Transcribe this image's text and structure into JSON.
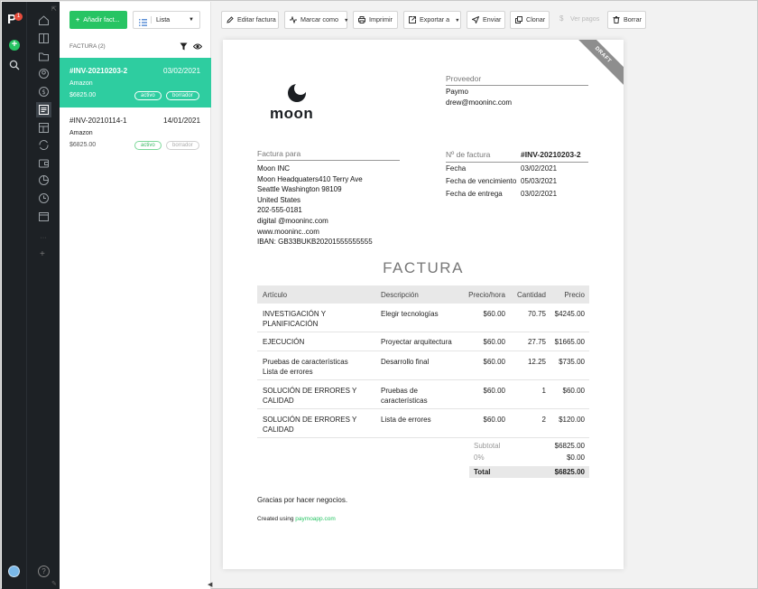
{
  "rail": {
    "logo_letter": "P",
    "notification_count": "1",
    "add_symbol": "+",
    "help_symbol": "?",
    "plus_symbol": "+",
    "divider": "···",
    "nav_icons": [
      "home-icon",
      "projects-icon",
      "folder-icon",
      "contacts-icon",
      "money-icon",
      "invoices-icon",
      "reports-icon",
      "sync-icon",
      "wallet-icon",
      "pie-chart-icon",
      "clock-icon",
      "calendar-icon"
    ]
  },
  "list": {
    "add_button": "Añadir fact...",
    "view_label": "Lista",
    "header": "FACTURA (2)",
    "invoices": [
      {
        "number": "#INV-20210203-2",
        "date": "03/02/2021",
        "client": "Amazon",
        "amount": "$6825.00",
        "badges": [
          "activo",
          "borrador"
        ]
      },
      {
        "number": "#INV-20210114-1",
        "date": "14/01/2021",
        "client": "Amazon",
        "amount": "$6825.00",
        "badges": [
          "activo",
          "borrador"
        ]
      }
    ]
  },
  "toolbar": {
    "edit": "Editar factura",
    "mark_as": "Marcar como",
    "print": "Imprimir",
    "export": "Exportar a",
    "send": "Enviar",
    "clone": "Clonar",
    "payments": "Ver pagos",
    "delete": "Borrar"
  },
  "invoice": {
    "ribbon": "DRAFT",
    "logo_text": "moon",
    "supplier": {
      "label": "Proveedor",
      "name": "Paymo",
      "email": "drew@mooninc.com"
    },
    "bill_to": {
      "label": "Factura para",
      "lines": [
        "Moon INC",
        "Moon Headquaters410 Terry Ave",
        "Seattle Washington 98109",
        "United States",
        "202-555-0181",
        "digital @mooninc.com",
        "www.mooninc..com",
        "IBAN: GB33BUKB20201555555555"
      ]
    },
    "meta": {
      "number_label": "Nº de factura",
      "number": "#INV-20210203-2",
      "date_label": "Fecha",
      "date": "03/02/2021",
      "due_label": "Fecha de vencimiento",
      "due": "05/03/2021",
      "delivery_label": "Fecha de entrega",
      "delivery": "03/02/2021"
    },
    "title": "FACTURA",
    "columns": {
      "item": "Artículo",
      "description": "Descripción",
      "rate": "Precio/hora",
      "qty": "Cantidad",
      "price": "Precio"
    },
    "items": [
      {
        "item": "INVESTIGACIÓN Y PLANIFICACIÓN",
        "description": "Elegir tecnologías",
        "rate": "$60.00",
        "qty": "70.75",
        "price": "$4245.00"
      },
      {
        "item": "EJECUCIÓN",
        "description": "Proyectar arquitectura",
        "rate": "$60.00",
        "qty": "27.75",
        "price": "$1665.00"
      },
      {
        "item": "Pruebas de características Lista de errores",
        "description": "Desarrollo final",
        "rate": "$60.00",
        "qty": "12.25",
        "price": "$735.00"
      },
      {
        "item": "SOLUCIÓN DE ERRORES Y CALIDAD",
        "description": "Pruebas de características",
        "rate": "$60.00",
        "qty": "1",
        "price": "$60.00"
      },
      {
        "item": "SOLUCIÓN DE ERRORES Y CALIDAD",
        "description": "Lista de errores",
        "rate": "$60.00",
        "qty": "2",
        "price": "$120.00"
      }
    ],
    "subtotal_label": "Subtotal",
    "subtotal": "$6825.00",
    "tax_label": "0%",
    "tax": "$0.00",
    "total_label": "Total",
    "total": "$6825.00",
    "thanks": "Gracias por hacer negocios.",
    "created_prefix": "Created using",
    "created_link": "paymoapp.com"
  },
  "colors": {
    "brand_green": "#27c463",
    "active_teal": "#2ecda0",
    "rail_dark": "#1d2125",
    "ribbon_grey": "#8e8e8e"
  }
}
